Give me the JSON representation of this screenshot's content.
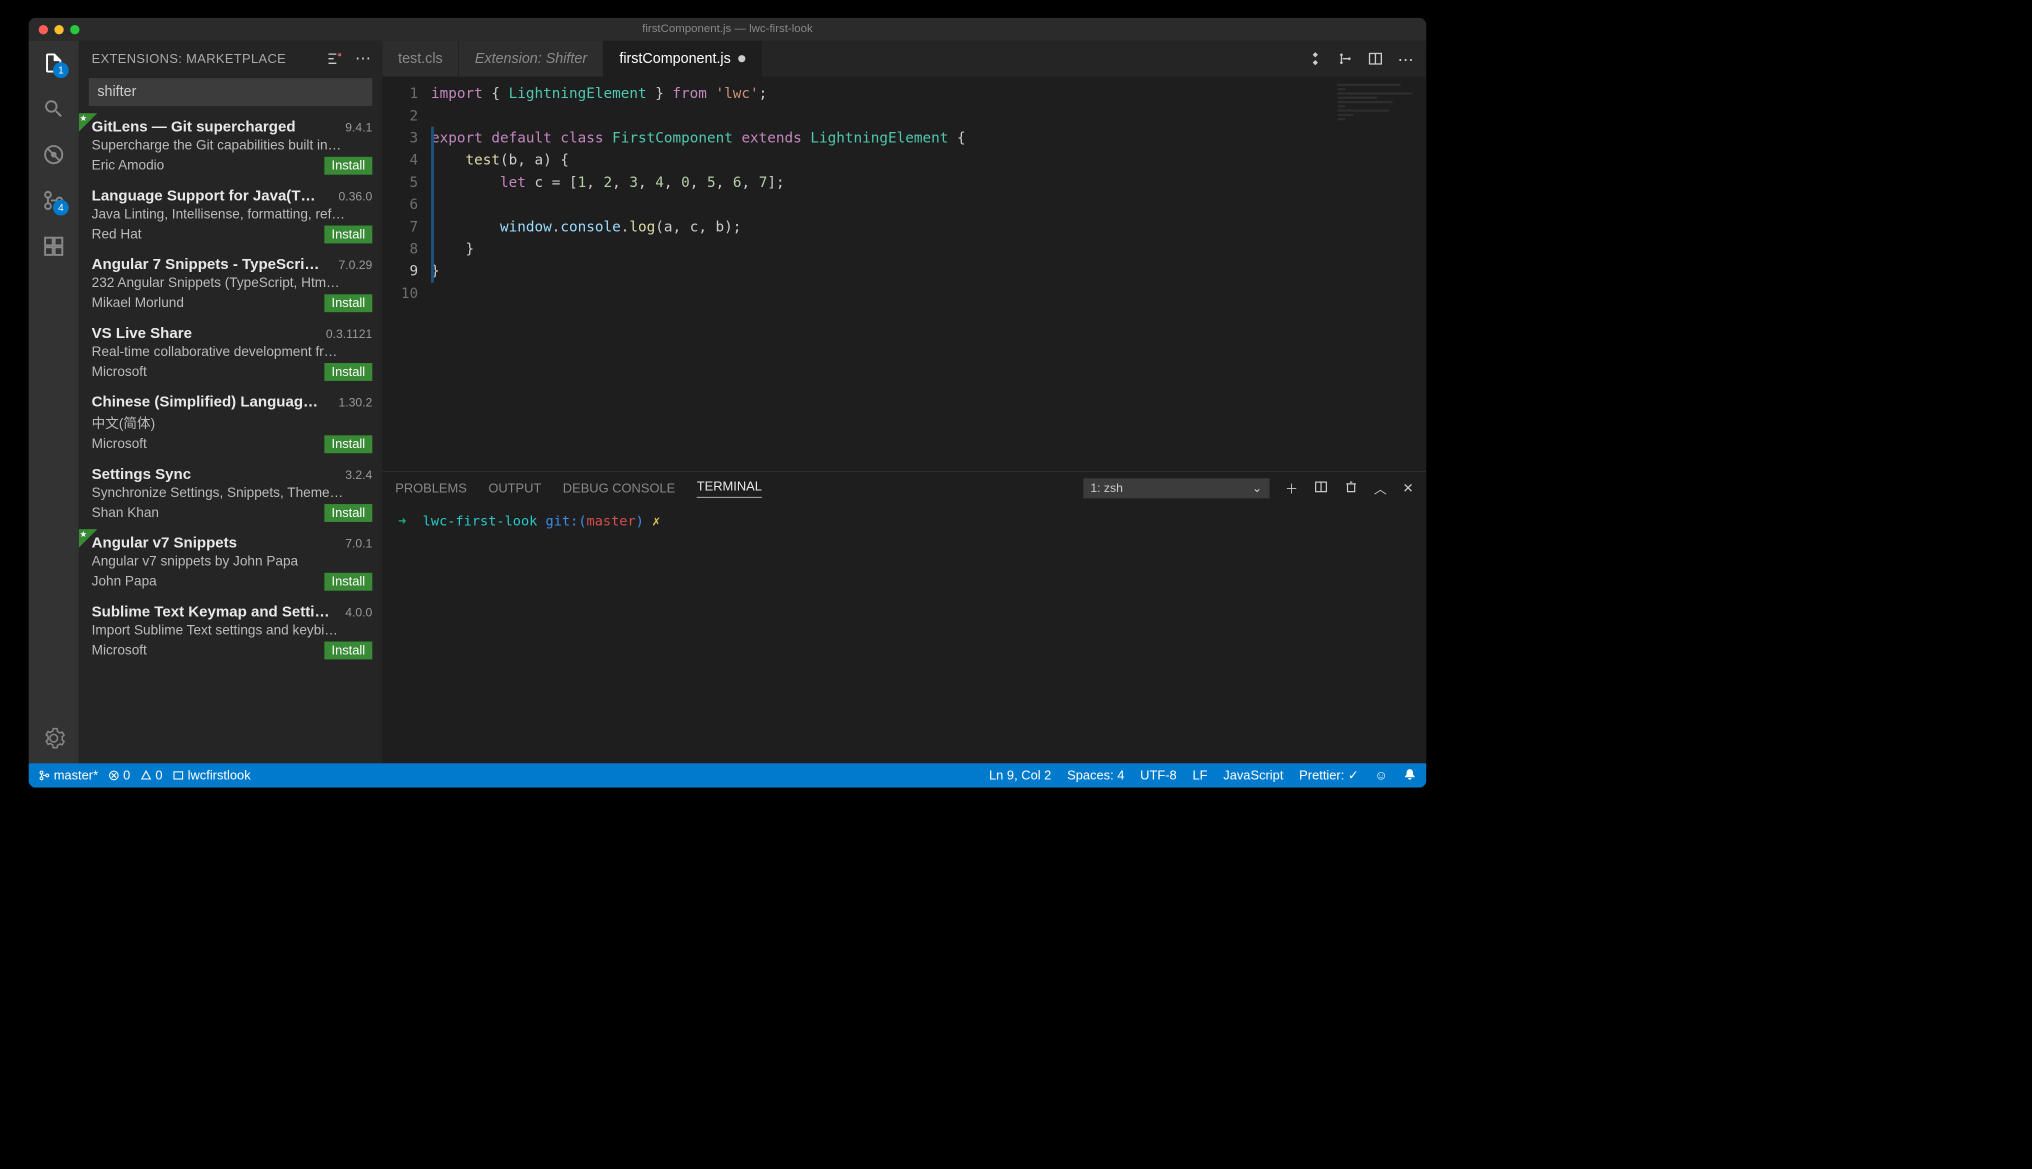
{
  "window": {
    "title": "firstComponent.js — lwc-first-look"
  },
  "activitybar": {
    "items": [
      "files",
      "search",
      "debug",
      "scm",
      "extensions"
    ],
    "files_badge": "1",
    "scm_badge": "4"
  },
  "sidebar": {
    "title": "EXTENSIONS: MARKETPLACE",
    "search_value": "shifter",
    "install_label": "Install",
    "extensions": [
      {
        "star": true,
        "name": "GitLens — Git supercharged",
        "version": "9.4.1",
        "desc": "Supercharge the Git capabilities built in…",
        "publisher": "Eric Amodio"
      },
      {
        "star": false,
        "name": "Language Support for Java(T…",
        "version": "0.36.0",
        "desc": "Java Linting, Intellisense, formatting, ref…",
        "publisher": "Red Hat"
      },
      {
        "star": false,
        "name": "Angular 7 Snippets - TypeScri…",
        "version": "7.0.29",
        "desc": "232 Angular Snippets (TypeScript, Htm…",
        "publisher": "Mikael Morlund"
      },
      {
        "star": false,
        "name": "VS Live Share",
        "version": "0.3.1121",
        "desc": "Real-time collaborative development fr…",
        "publisher": "Microsoft"
      },
      {
        "star": false,
        "name": "Chinese (Simplified) Languag…",
        "version": "1.30.2",
        "desc": "中文(简体)",
        "publisher": "Microsoft"
      },
      {
        "star": false,
        "name": "Settings Sync",
        "version": "3.2.4",
        "desc": "Synchronize Settings, Snippets, Theme…",
        "publisher": "Shan Khan"
      },
      {
        "star": true,
        "name": "Angular v7 Snippets",
        "version": "7.0.1",
        "desc": "Angular v7 snippets by John Papa",
        "publisher": "John Papa"
      },
      {
        "star": false,
        "name": "Sublime Text Keymap and Setti…",
        "version": "4.0.0",
        "desc": "Import Sublime Text settings and keybi…",
        "publisher": "Microsoft"
      }
    ]
  },
  "tabs": [
    {
      "label": "test.cls",
      "active": false,
      "italic": false
    },
    {
      "label": "Extension: Shifter",
      "active": false,
      "italic": true
    },
    {
      "label": "firstComponent.js",
      "active": true,
      "italic": false,
      "dirty": true
    }
  ],
  "editor": {
    "line_count": 10,
    "current_line": 9,
    "code_lines": [
      "import { LightningElement } from 'lwc';",
      "",
      "export default class FirstComponent extends LightningElement {",
      "    test(b, a) {",
      "        let c = [1, 2, 3, 4, 0, 5, 6, 7];",
      "",
      "        window.console.log(a, c, b);",
      "    }",
      "}",
      ""
    ]
  },
  "panel": {
    "tabs": [
      "PROBLEMS",
      "OUTPUT",
      "DEBUG CONSOLE",
      "TERMINAL"
    ],
    "active_tab": "TERMINAL",
    "selector": "1: zsh",
    "terminal_line": {
      "arrow": "➜",
      "path": "lwc-first-look",
      "git": "git:(",
      "branch": "master",
      "close": ")",
      "x": "✗"
    }
  },
  "statusbar": {
    "branch": "master*",
    "errors": "0",
    "warnings": "0",
    "project_icon_label": "lwcfirstlook",
    "ln_col": "Ln 9, Col 2",
    "spaces": "Spaces: 4",
    "encoding": "UTF-8",
    "eol": "LF",
    "lang": "JavaScript",
    "prettier": "Prettier: ✓"
  }
}
